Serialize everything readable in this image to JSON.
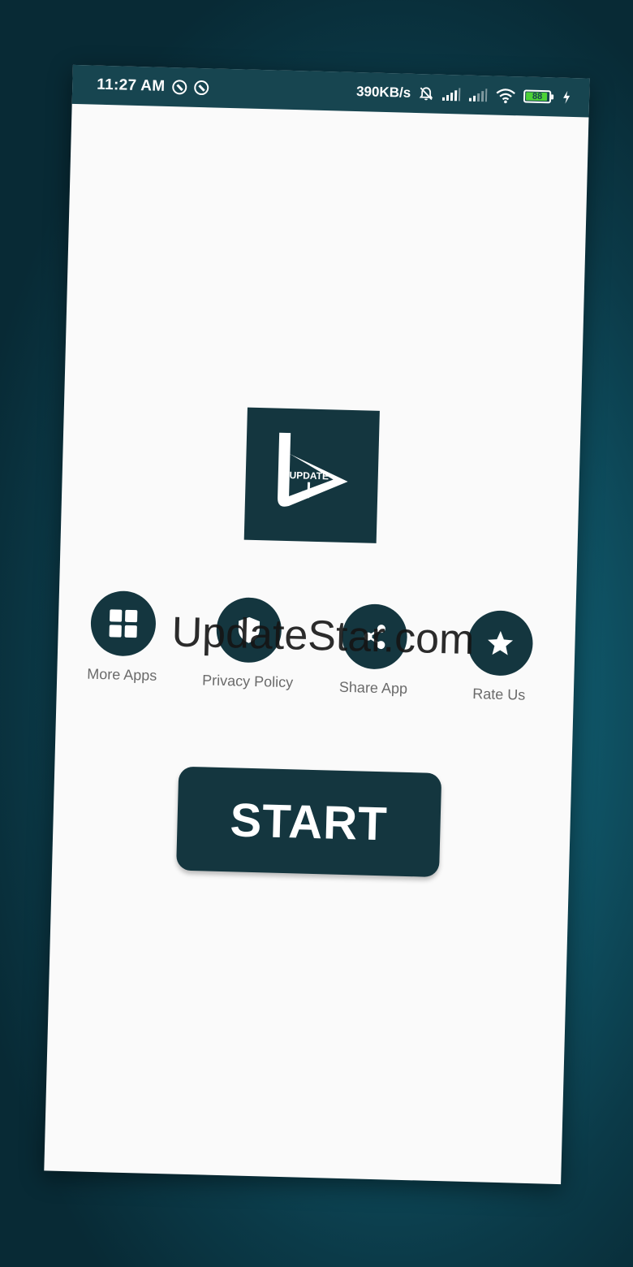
{
  "status_bar": {
    "time": "11:27 AM",
    "net_speed": "390KB/s",
    "battery_level": "88",
    "icons": [
      "notification-ring-icon",
      "notification-ring-icon",
      "muted-bell-icon",
      "signal-icon",
      "signal-icon",
      "wifi-icon",
      "battery-icon",
      "charging-icon"
    ]
  },
  "app": {
    "logo_text": "UPDATE"
  },
  "menu": {
    "items": [
      {
        "label": "More Apps",
        "icon": "grid-icon"
      },
      {
        "label": "Privacy Policy",
        "icon": "shield-icon"
      },
      {
        "label": "Share App",
        "icon": "share-icon"
      },
      {
        "label": "Rate Us",
        "icon": "star-icon"
      }
    ]
  },
  "watermark": "UpdateStar.com",
  "start_button": {
    "label": "START"
  },
  "colors": {
    "primary": "#14363f",
    "status_bar": "#174550",
    "screen_bg": "#fafafa",
    "label_gray": "#6a6a6a",
    "battery_green": "#4cd137"
  }
}
